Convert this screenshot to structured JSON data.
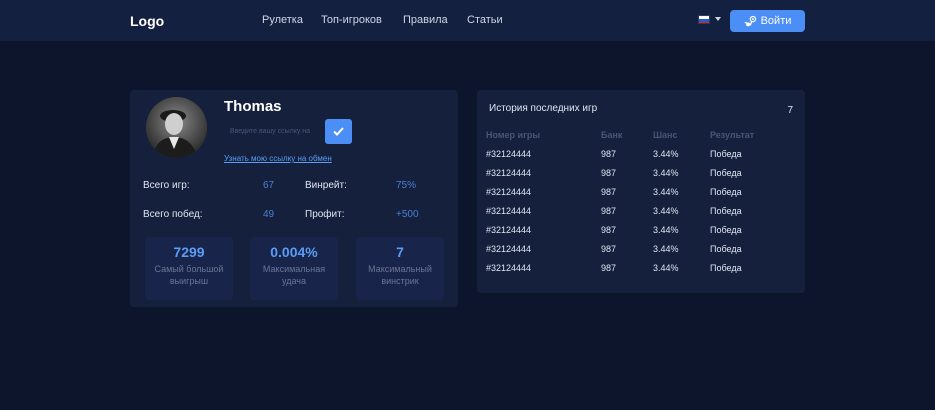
{
  "header": {
    "logo": "Logo",
    "nav": [
      {
        "label": "Рулетка"
      },
      {
        "label": "Топ-игроков"
      },
      {
        "label": "Правила"
      },
      {
        "label": "Статьи"
      }
    ],
    "language_flag": "ru-flag-icon",
    "login_label": "Войти",
    "login_icon": "steam-icon"
  },
  "profile": {
    "username": "Thomas",
    "link_placeholder": "Введите вашу ссылку на",
    "link_value": "",
    "trade_link_label": "Узнать мою ссылку на обмен",
    "stats": [
      {
        "label": "Всего игр:",
        "value": "67"
      },
      {
        "label": "Винрейт:",
        "value": "75%"
      },
      {
        "label": "Всего побед:",
        "value": "49"
      },
      {
        "label": "Профит:",
        "value": "+500"
      }
    ],
    "tiles": [
      {
        "value": "7299",
        "label": "Самый большой выигрыш"
      },
      {
        "value": "0.004%",
        "label": "Максимальная удача"
      },
      {
        "value": "7",
        "label": "Максимальный винстрик"
      }
    ]
  },
  "history": {
    "title": "История последних игр",
    "count": "7",
    "columns": [
      "Номер игры",
      "Банк",
      "Шанс",
      "Результат"
    ],
    "rows": [
      [
        "#32124444",
        "987",
        "3.44%",
        "Победа"
      ],
      [
        "#32124444",
        "987",
        "3.44%",
        "Победа"
      ],
      [
        "#32124444",
        "987",
        "3.44%",
        "Победа"
      ],
      [
        "#32124444",
        "987",
        "3.44%",
        "Победа"
      ],
      [
        "#32124444",
        "987",
        "3.44%",
        "Победа"
      ],
      [
        "#32124444",
        "987",
        "3.44%",
        "Победа"
      ],
      [
        "#32124444",
        "987",
        "3.44%",
        "Победа"
      ]
    ]
  },
  "colors": {
    "background": "#0d152c",
    "header": "#14203f",
    "card": "#15203d",
    "accent": "#4b8ef5",
    "value_blue": "#4a7fd6"
  }
}
